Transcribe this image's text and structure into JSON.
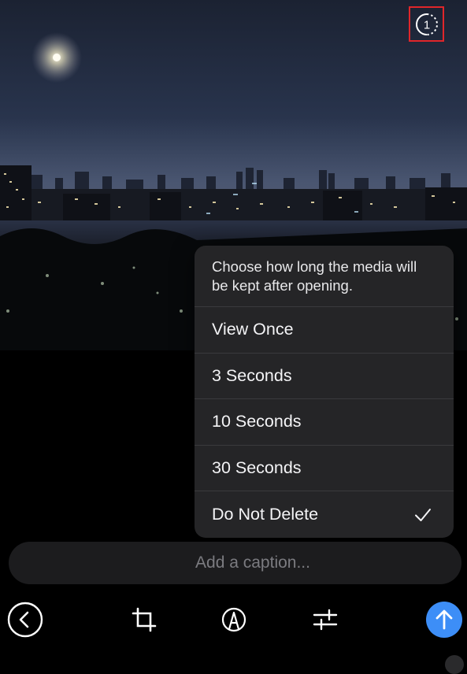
{
  "timer_menu": {
    "description": "Choose how long the media will be kept after opening.",
    "options": [
      {
        "label": "View Once",
        "selected": false
      },
      {
        "label": "3 Seconds",
        "selected": false
      },
      {
        "label": "10 Seconds",
        "selected": false
      },
      {
        "label": "30 Seconds",
        "selected": false
      },
      {
        "label": "Do Not Delete",
        "selected": true
      }
    ]
  },
  "caption": {
    "placeholder": "Add a caption...",
    "value": ""
  },
  "timer_button": {
    "icon": "timer-once-icon",
    "glyph": "1"
  },
  "toolbar": {
    "back_icon": "chevron-left-icon",
    "crop_icon": "crop-icon",
    "markup_icon": "markup-pen-icon",
    "adjust_icon": "sliders-icon",
    "send_icon": "arrow-up-icon"
  },
  "colors": {
    "accent": "#3d8ef7",
    "highlight": "#e0262a",
    "menu_bg": "#262628",
    "caption_bg": "#1c1c1e"
  }
}
